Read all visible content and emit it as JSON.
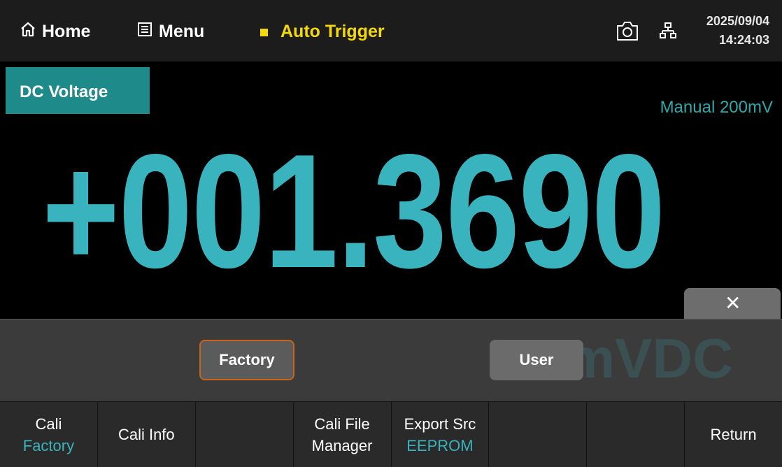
{
  "topbar": {
    "home_label": "Home",
    "menu_label": "Menu",
    "trigger_label": "Auto Trigger",
    "date": "2025/09/04",
    "time": "14:24:03",
    "icons": [
      "home-icon",
      "menu-icon",
      "camera-icon",
      "network-icon"
    ]
  },
  "measurement": {
    "function": "DC Voltage",
    "range": "Manual 200mV",
    "reading": "+001.3690",
    "unit": "mVDC"
  },
  "popup": {
    "close_symbol": "✕",
    "factory_label": "Factory",
    "user_label": "User"
  },
  "softkeys": [
    {
      "label": "Cali",
      "sub": "Factory"
    },
    {
      "label": "Cali Info",
      "sub": ""
    },
    {
      "label": "",
      "sub": ""
    },
    {
      "label": "Cali File\nManager",
      "sub": ""
    },
    {
      "label": "Export Src",
      "sub": "EEPROM"
    },
    {
      "label": "",
      "sub": ""
    },
    {
      "label": "",
      "sub": ""
    },
    {
      "label": "Return",
      "sub": ""
    }
  ],
  "colors": {
    "accent": "#39b3bd",
    "trigger": "#f5d90a",
    "function_bg": "#1f8a8a",
    "selected_border": "#c8641b"
  }
}
